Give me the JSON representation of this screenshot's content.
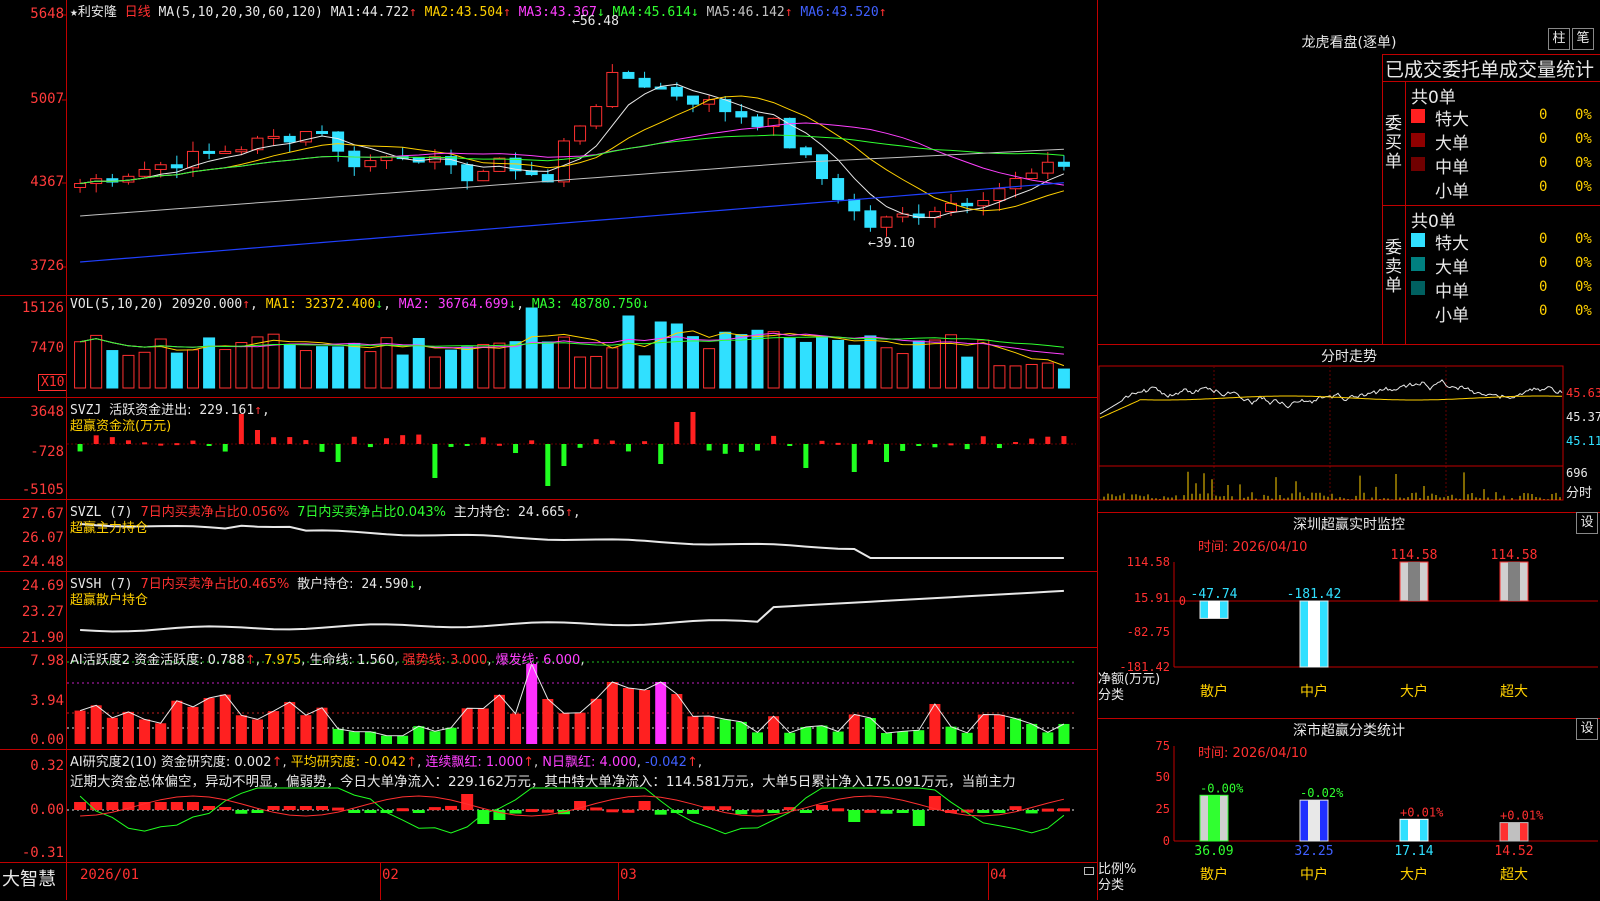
{
  "main": {
    "title_star": "★",
    "stock_name": "利安隆",
    "period": "日线",
    "ma_label": "MA(5,10,20,30,60,120)",
    "ma": [
      {
        "label": "MA1:",
        "value": "44.722",
        "arrow": "↑",
        "color": "#e8e8e8"
      },
      {
        "label": "MA2:",
        "value": "43.504",
        "arrow": "↑",
        "color": "#ffd000"
      },
      {
        "label": "MA3:",
        "value": "43.367",
        "arrow": "↓",
        "color": "#ff40ff"
      },
      {
        "label": "MA4:",
        "value": "45.614",
        "arrow": "↓",
        "color": "#30ff30"
      },
      {
        "label": "MA5:",
        "value": "46.142",
        "arrow": "↑",
        "color": "#c0c0c0"
      },
      {
        "label": "MA6:",
        "value": "43.520",
        "arrow": "↑",
        "color": "#4060ff"
      }
    ],
    "yticks": [
      "5648",
      "5007",
      "4367",
      "3726"
    ],
    "annot_high": "56.48",
    "annot_low": "39.10"
  },
  "vol": {
    "header": "VOL(5,10,20)",
    "value": "20920.000",
    "ma1": "32372.400",
    "ma2": "36764.699",
    "ma3": "48780.750",
    "arrow_v": "↑",
    "arrow1": "↓",
    "arrow2": "↓",
    "arrow3": "↓",
    "yticks": [
      "15126",
      "7470"
    ],
    "unit": "X10"
  },
  "svzj": {
    "header": "SVZJ",
    "label": "活跃资金进出:",
    "value": "229.161",
    "arrow": "↑",
    "sub": "超赢资金流(万元)",
    "yticks": [
      "3648",
      "-728",
      "-5105"
    ]
  },
  "svzl": {
    "header": "SVZL (7)",
    "t1": "7日内买卖净占比0.056%",
    "t2": "7日内买卖净占比0.043%",
    "t3": "主力持仓:",
    "v3": "24.665",
    "arrow": "↑",
    "sub": "超赢主力持仓",
    "yticks": [
      "27.67",
      "26.07",
      "24.48"
    ]
  },
  "svsh": {
    "header": "SVSH (7)",
    "t1": "7日内买卖净占比0.465%",
    "t2": "散户持仓:",
    "v2": "24.590",
    "arrow": "↓",
    "sub": "超赢散户持仓",
    "yticks": [
      "24.69",
      "23.27",
      "21.90"
    ]
  },
  "ai1": {
    "header": "AI活跃度2",
    "l1": "资金活跃度:",
    "v1": "0.788",
    "a1": "↑",
    "v2": "7.975",
    "l3": "生命线:",
    "v3": "1.560",
    "l4": "强势线:",
    "v4": "3.000",
    "l5": "爆发线:",
    "v5": "6.000",
    "yticks": [
      "7.98",
      "3.94",
      "0.00"
    ]
  },
  "ai2": {
    "header": "AI研究度2(10)",
    "l1": "资金研究度:",
    "v1": "0.002",
    "a1": "↑",
    "l2": "平均研究度:",
    "v2": "-0.042",
    "a2": "↑",
    "l3": "连续飘红:",
    "v3": "1.000",
    "a3": "↑",
    "l4": "N日飘红:",
    "v4": "4.000",
    "v5": "-0.042",
    "a5": "↑",
    "comment": "近期大资金总体偏空，异动不明显，偏弱势，今日大单净流入：229.162万元，其中特大单净流入：114.581万元，大单5日累计净入175.091万元，当前主力",
    "yticks": [
      "0.32",
      "0.00",
      "-0.31"
    ]
  },
  "xaxis": {
    "brand": "大智慧",
    "labels": [
      "2026/01",
      "02",
      "03",
      "04"
    ]
  },
  "right": {
    "dragon_title": "龙虎看盘(逐单)",
    "btn1": "柱",
    "btn2": "笔",
    "order_title": "已成交委托单成交量统计",
    "buy_side": "委买单",
    "sell_side": "委卖单",
    "buy_total": "共0单",
    "sell_total": "共0单",
    "buy_rows": [
      {
        "name": "特大",
        "count": "0",
        "pct": "0%",
        "color": "#ff2020"
      },
      {
        "name": "大单",
        "count": "0",
        "pct": "0%",
        "color": "#900000"
      },
      {
        "name": "中单",
        "count": "0",
        "pct": "0%",
        "color": "#700000"
      },
      {
        "name": "小单",
        "count": "0",
        "pct": "0%",
        "color": "#000000"
      }
    ],
    "sell_rows": [
      {
        "name": "特大",
        "count": "0",
        "pct": "0%",
        "color": "#30e0ff"
      },
      {
        "name": "大单",
        "count": "0",
        "pct": "0%",
        "color": "#008080"
      },
      {
        "name": "中单",
        "count": "0",
        "pct": "0%",
        "color": "#006060"
      },
      {
        "name": "小单",
        "count": "0",
        "pct": "0%",
        "color": "#000000"
      }
    ],
    "intraday_title": "分时走势",
    "intraday_y": [
      "45.63",
      "45.37",
      "45.11"
    ],
    "intraday_vol": "696",
    "intraday_unit": "分时",
    "sz_title": "深圳超赢实时监控",
    "sz_btn": "设",
    "sz_time": "时间: 2026/04/10",
    "sz_y": [
      "114.58",
      "15.91",
      "-82.75",
      "-181.42"
    ],
    "sz_yzero": "0",
    "sz_bar_vals": [
      "-47.74",
      "-181.42",
      "114.58",
      "114.58"
    ],
    "sz_axis_label": "净额(万元)",
    "sz_axis_label2": "分类",
    "sz_cats": [
      "散户",
      "中户",
      "大户",
      "超大"
    ],
    "cls_title": "深市超赢分类统计",
    "cls_btn": "设",
    "cls_time": "时间: 2026/04/10",
    "cls_y": [
      "75",
      "50",
      "25",
      "0"
    ],
    "cls_bar_top": [
      "-0.00%",
      "-0.02%",
      "+0.01%",
      "+0.01%"
    ],
    "cls_bar_vals": [
      "36.09",
      "32.25",
      "17.14",
      "14.52"
    ],
    "cls_axis_label": "比例%",
    "cls_axis_label2": "分类",
    "cls_cats": [
      "散户",
      "中户",
      "大户",
      "超大"
    ]
  }
}
